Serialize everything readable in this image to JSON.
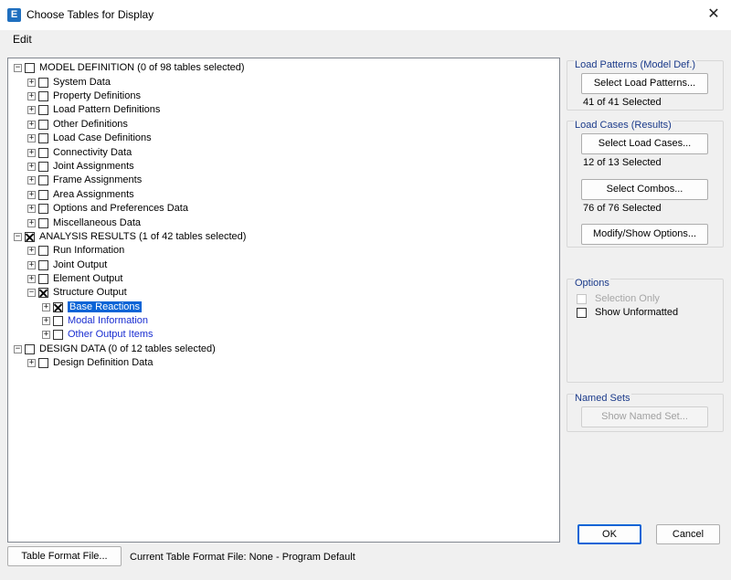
{
  "window": {
    "title": "Choose Tables for Display",
    "app_icon": "E",
    "close": "✕"
  },
  "menu": {
    "edit": "Edit"
  },
  "tree": {
    "model_definition": "MODEL DEFINITION  (0 of 98 tables selected)",
    "system_data": "System Data",
    "property_definitions": "Property Definitions",
    "load_pattern_definitions": "Load Pattern Definitions",
    "other_definitions": "Other Definitions",
    "load_case_definitions": "Load Case Definitions",
    "connectivity_data": "Connectivity Data",
    "joint_assignments": "Joint Assignments",
    "frame_assignments": "Frame Assignments",
    "area_assignments": "Area Assignments",
    "options_preferences": "Options and Preferences Data",
    "misc_data": "Miscellaneous Data",
    "analysis_results": "ANALYSIS RESULTS  (1 of 42 tables selected)",
    "run_information": "Run Information",
    "joint_output": "Joint Output",
    "element_output": "Element Output",
    "structure_output": "Structure Output",
    "base_reactions": "Base Reactions",
    "modal_information": "Modal Information",
    "other_output_items": "Other Output Items",
    "design_data": "DESIGN DATA  (0 of 12 tables selected)",
    "design_definition_data": "Design Definition Data"
  },
  "load_patterns": {
    "title": "Load Patterns (Model Def.)",
    "button": "Select Load Patterns...",
    "status": "41 of 41 Selected"
  },
  "load_cases": {
    "title": "Load Cases (Results)",
    "cases_button": "Select Load Cases...",
    "cases_status": "12 of 13 Selected",
    "combos_button": "Select Combos...",
    "combos_status": "76 of 76 Selected",
    "modify_button": "Modify/Show Options..."
  },
  "options": {
    "title": "Options",
    "selection_only": "Selection Only",
    "show_unformatted": "Show Unformatted"
  },
  "named_sets": {
    "title": "Named Sets",
    "button": "Show Named Set..."
  },
  "footer": {
    "ok": "OK",
    "cancel": "Cancel",
    "table_format_button": "Table Format File...",
    "current_format": "Current Table Format File:  None - Program Default"
  },
  "colors": {
    "selection": "#0a64d6",
    "link_blue": "#1a2ed1",
    "group_title": "#1a3a8a"
  }
}
